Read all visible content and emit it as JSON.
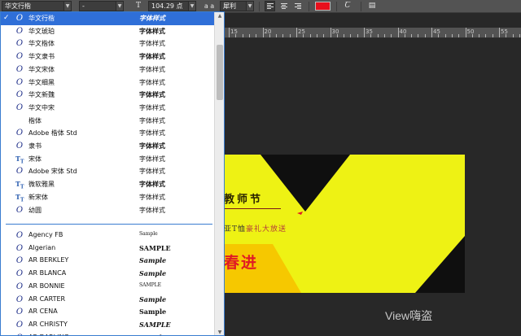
{
  "toolbar": {
    "font_family": "华文行楷",
    "font_style": "-",
    "size_icon": "font-size-icon",
    "font_size": "104.29 点",
    "aa_label": "a a",
    "antialias": "犀利",
    "color": "#e8101c",
    "warp_icon": "warp-text-icon",
    "panel_icon": "character-panel-icon"
  },
  "ruler": {
    "labels": [
      "15",
      "20",
      "25",
      "30",
      "35",
      "40",
      "45",
      "50",
      "55"
    ]
  },
  "font_list": {
    "selected_index": 0,
    "items": [
      {
        "name": "华文行楷",
        "sample": "字体样式",
        "icon": "opentype-icon",
        "sample_style": "ital"
      },
      {
        "name": "华文琥珀",
        "sample": "字体样式",
        "icon": "opentype-icon",
        "sample_style": "bold"
      },
      {
        "name": "华文楷体",
        "sample": "字体样式",
        "icon": "opentype-icon",
        "sample_style": ""
      },
      {
        "name": "华文隶书",
        "sample": "字体样式",
        "icon": "opentype-icon",
        "sample_style": "bold"
      },
      {
        "name": "华文宋体",
        "sample": "字体样式",
        "icon": "opentype-icon",
        "sample_style": ""
      },
      {
        "name": "华文细黑",
        "sample": "字体样式",
        "icon": "opentype-icon",
        "sample_style": ""
      },
      {
        "name": "华文新魏",
        "sample": "字体样式",
        "icon": "opentype-icon",
        "sample_style": "bold"
      },
      {
        "name": "华文中宋",
        "sample": "字体样式",
        "icon": "opentype-icon",
        "sample_style": ""
      },
      {
        "name": "楷体",
        "sample": "字体样式",
        "icon": "",
        "sample_style": ""
      },
      {
        "name": "Adobe 楷体 Std",
        "sample": "字体样式",
        "icon": "opentype-icon",
        "sample_style": ""
      },
      {
        "name": "隶书",
        "sample": "字体样式",
        "icon": "opentype-icon",
        "sample_style": "bold"
      },
      {
        "name": "宋体",
        "sample": "字体样式",
        "icon": "truetype-icon",
        "sample_style": ""
      },
      {
        "name": "Adobe 宋体 Std",
        "sample": "字体样式",
        "icon": "opentype-icon",
        "sample_style": ""
      },
      {
        "name": "微软雅黑",
        "sample": "字体样式",
        "icon": "truetype-icon",
        "sample_style": "bold"
      },
      {
        "name": "新宋体",
        "sample": "字体样式",
        "icon": "truetype-icon",
        "sample_style": ""
      },
      {
        "name": "幼圆",
        "sample": "字体样式",
        "icon": "opentype-icon",
        "sample_style": ""
      }
    ],
    "latin_items": [
      {
        "name": "Agency FB",
        "sample": "Sample",
        "icon": "opentype-icon",
        "sample_style": "small"
      },
      {
        "name": "Algerian",
        "sample": "SAMPLE",
        "icon": "opentype-icon",
        "sample_style": "bold"
      },
      {
        "name": "AR BERKLEY",
        "sample": "Sample",
        "icon": "opentype-icon",
        "sample_style": "ital"
      },
      {
        "name": "AR BLANCA",
        "sample": "Sample",
        "icon": "opentype-icon",
        "sample_style": "ital"
      },
      {
        "name": "AR BONNIE",
        "sample": "SAMPLE",
        "icon": "opentype-icon",
        "sample_style": "small"
      },
      {
        "name": "AR CARTER",
        "sample": "Sample",
        "icon": "opentype-icon",
        "sample_style": "ital"
      },
      {
        "name": "AR CENA",
        "sample": "Sample",
        "icon": "opentype-icon",
        "sample_style": "bold"
      },
      {
        "name": "AR CHRISTY",
        "sample": "SAMPLE",
        "icon": "opentype-icon",
        "sample_style": "ital"
      },
      {
        "name": "AR DARLING",
        "sample": "Sample",
        "icon": "opentype-icon",
        "sample_style": "bold"
      }
    ]
  },
  "canvas_text": {
    "title": "教师节",
    "subtitle": "亚T恤",
    "subtitle_red": "豪礼大放送",
    "headline": "春进"
  },
  "watermark": "View嗨盗"
}
